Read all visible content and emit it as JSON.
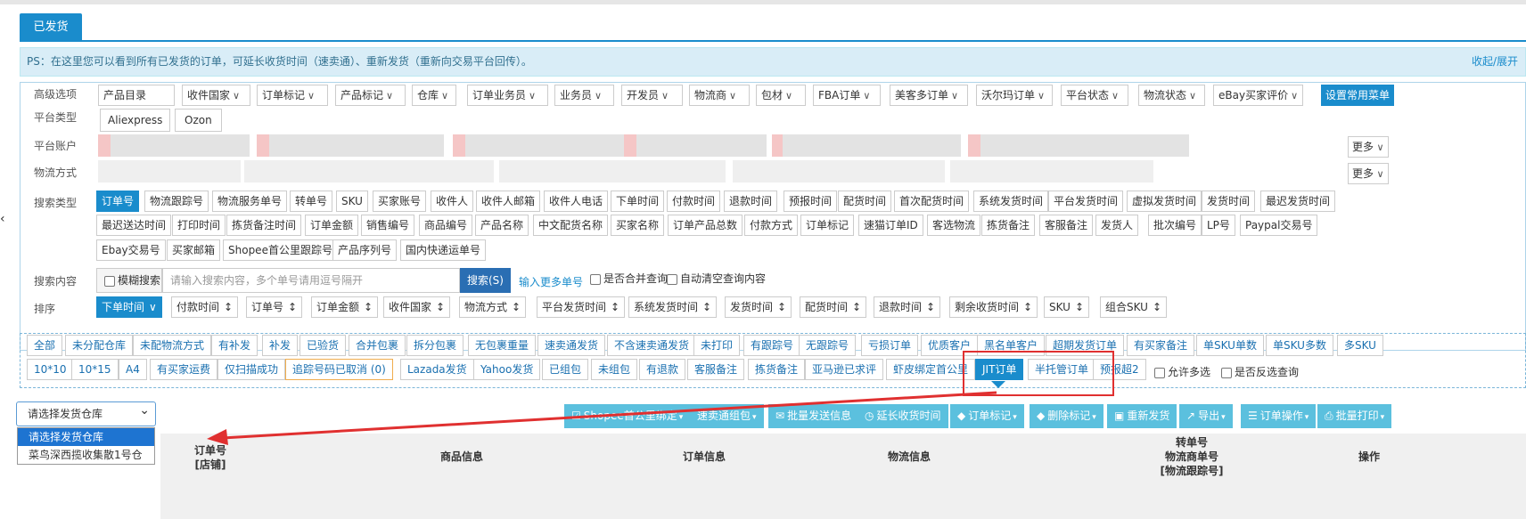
{
  "tabs": {
    "active": "已发货"
  },
  "notice": {
    "text": "PS：在这里您可以看到所有已发货的订单，可延长收货时间（速卖通）、重新发货（重新向交易平台回传）。",
    "toggle": "收起/展开"
  },
  "labels": {
    "advanced": "高级选项",
    "platform_type": "平台类型",
    "platform_account": "平台账户",
    "logistics": "物流方式",
    "search_type": "搜索类型",
    "search_content": "搜索内容",
    "sort": "排序"
  },
  "advanced_options": [
    "产品目录",
    "收件国家",
    "订单标记",
    "产品标记",
    "仓库",
    "订单业务员",
    "业务员",
    "开发员",
    "物流商",
    "包材",
    "FBA订单",
    "美客多订单",
    "沃尔玛订单",
    "平台状态",
    "物流状态",
    "eBay买家评价"
  ],
  "set_common_menu": "设置常用菜单",
  "platform_types": [
    "Aliexpress",
    "Ozon"
  ],
  "more_label": "更多",
  "search_types_row1": [
    "订单号",
    "物流跟踪号",
    "物流服务单号",
    "转单号",
    "SKU",
    "买家账号",
    "收件人",
    "收件人邮箱",
    "收件人电话",
    "下单时间",
    "付款时间",
    "退款时间",
    "预报时间",
    "配货时间",
    "首次配货时间",
    "系统发货时间",
    "平台发货时间",
    "虚拟发货时间",
    "发货时间",
    "最迟发货时间"
  ],
  "search_types_row2": [
    "最迟送达时间",
    "打印时间",
    "拣货备注时间",
    "订单金额",
    "销售编号",
    "商品编号",
    "产品名称",
    "中文配货名称",
    "买家名称",
    "订单产品总数",
    "付款方式",
    "订单标记",
    "速猫订单ID",
    "客选物流",
    "拣货备注",
    "客服备注",
    "发货人",
    "批次编号",
    "LP号",
    "Paypal交易号"
  ],
  "search_types_row3": [
    "Ebay交易号",
    "买家邮箱",
    "Shopee首公里跟踪号",
    "产品序列号",
    "国内快递运单号"
  ],
  "search": {
    "fuzzy": "模糊搜索",
    "placeholder": "请输入搜索内容，多个单号请用逗号隔开",
    "button": "搜索(S)",
    "more_numbers": "输入更多单号",
    "merge_query": "是否合并查询",
    "auto_clear": "自动清空查询内容"
  },
  "sort_items": [
    "下单时间",
    "付款时间",
    "订单号",
    "订单金额",
    "收件国家",
    "物流方式",
    "平台发货时间",
    "系统发货时间",
    "发货时间",
    "配货时间",
    "退款时间",
    "剩余收货时间",
    "SKU",
    "组合SKU"
  ],
  "quick_row1": [
    "全部",
    "未分配仓库",
    "未配物流方式",
    "有补发",
    "补发",
    "已验货",
    "合并包裹",
    "拆分包裹",
    "无包裹重量",
    "速卖通发货",
    "不含速卖通发货",
    "未打印",
    "有跟踪号",
    "无跟踪号",
    "亏损订单",
    "优质客户",
    "黑名单客户",
    "超期发货订单",
    "有买家备注",
    "单SKU单数",
    "单SKU多数",
    "多SKU"
  ],
  "quick_row2": [
    "10*10",
    "10*15",
    "A4",
    "有买家运费",
    "仅扫描成功",
    "追踪号码已取消 (0)",
    "Lazada发货",
    "Yahoo发货",
    "已组包",
    "未组包",
    "有退款",
    "客服备注",
    "拣货备注",
    "亚马逊已求评",
    "虾皮绑定首公里",
    "JIT订单",
    "半托管订单",
    "预报超2"
  ],
  "quick_checks": {
    "allow_multi": "允许多选",
    "reverse": "是否反选查询"
  },
  "warehouse_select": {
    "value": "请选择发货仓库",
    "options": [
      "请选择发货仓库",
      "菜鸟深西揽收集散1号仓"
    ]
  },
  "actions": [
    "Shopee首公里绑定",
    "速卖通组包",
    "批量发送信息",
    "延长收货时间",
    "订单标记",
    "删除标记",
    "重新发货",
    "导出",
    "订单操作",
    "批量打印"
  ],
  "table_headers": {
    "order": "订单号",
    "store": "[店铺]",
    "goods": "商品信息",
    "order_info": "订单信息",
    "logistics": "物流信息",
    "transfer": "转单号",
    "carrier_no": "物流商单号",
    "tracking": "[物流跟踪号]",
    "ops": "操作"
  }
}
